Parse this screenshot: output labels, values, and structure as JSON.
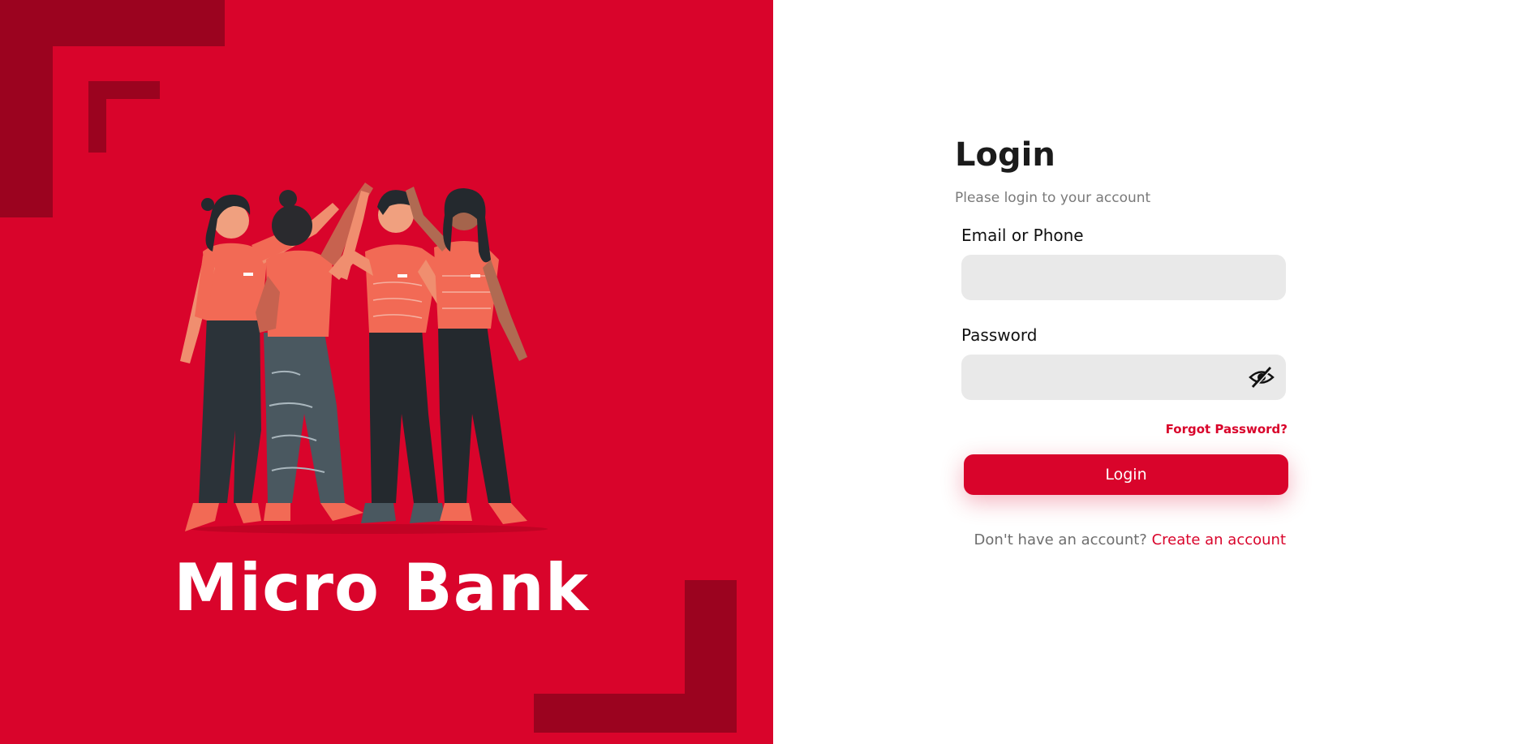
{
  "brand": {
    "name": "Micro Bank",
    "panel_color": "#d9042b",
    "accent_dark": "#9b031f",
    "illustration": "team-high-five-illustration"
  },
  "login": {
    "title": "Login",
    "subtitle": "Please login to your account",
    "email_label": "Email or Phone",
    "email_value": "",
    "password_label": "Password",
    "password_value": "",
    "password_toggle_icon": "eye-slash-icon",
    "forgot_password": "Forgot Password?",
    "submit_label": "Login",
    "no_account_text": "Don't have an account?",
    "create_account": "Create an account"
  }
}
